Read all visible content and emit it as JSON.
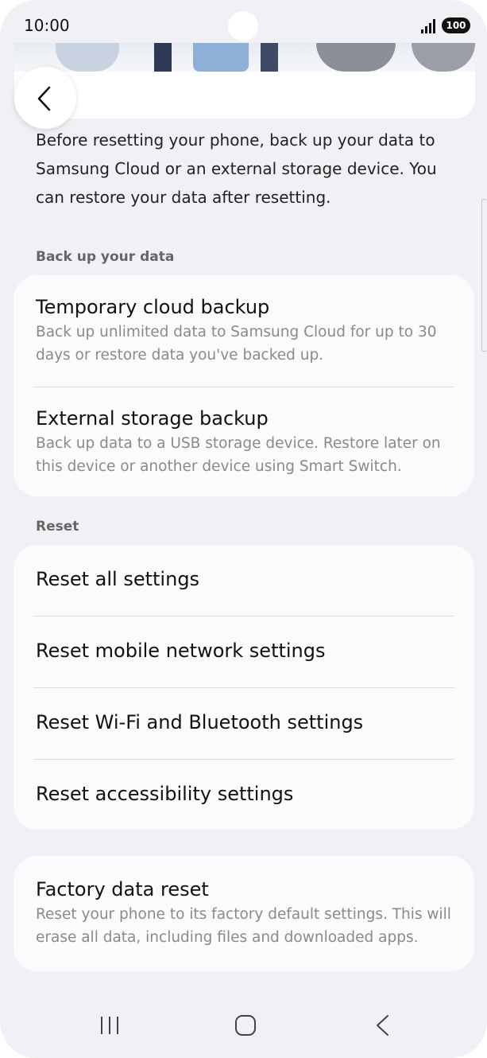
{
  "status_bar": {
    "time": "10:00",
    "battery": "100"
  },
  "intro_text": "Before resetting your phone, back up your data to Samsung Cloud or an external storage device. You can restore your data after resetting.",
  "backup_section": {
    "title": "Back up your data",
    "items": [
      {
        "title": "Temporary cloud backup",
        "description": "Back up unlimited data to Samsung Cloud for up to 30 days or restore data you've backed up."
      },
      {
        "title": "External storage backup",
        "description": "Back up data to a USB storage device. Restore later on this device or another device using Smart Switch."
      }
    ]
  },
  "reset_section": {
    "title": "Reset",
    "items": [
      {
        "title": "Reset all settings"
      },
      {
        "title": "Reset mobile network settings"
      },
      {
        "title": "Reset Wi-Fi and Bluetooth settings"
      },
      {
        "title": "Reset accessibility settings"
      }
    ]
  },
  "factory_reset": {
    "title": "Factory data reset",
    "description": "Reset your phone to its factory default settings. This will erase all data, including files and downloaded apps."
  },
  "icons": {
    "back": "chevron-left-icon",
    "recents": "recents-icon",
    "home": "home-icon",
    "nav_back": "nav-back-icon"
  }
}
